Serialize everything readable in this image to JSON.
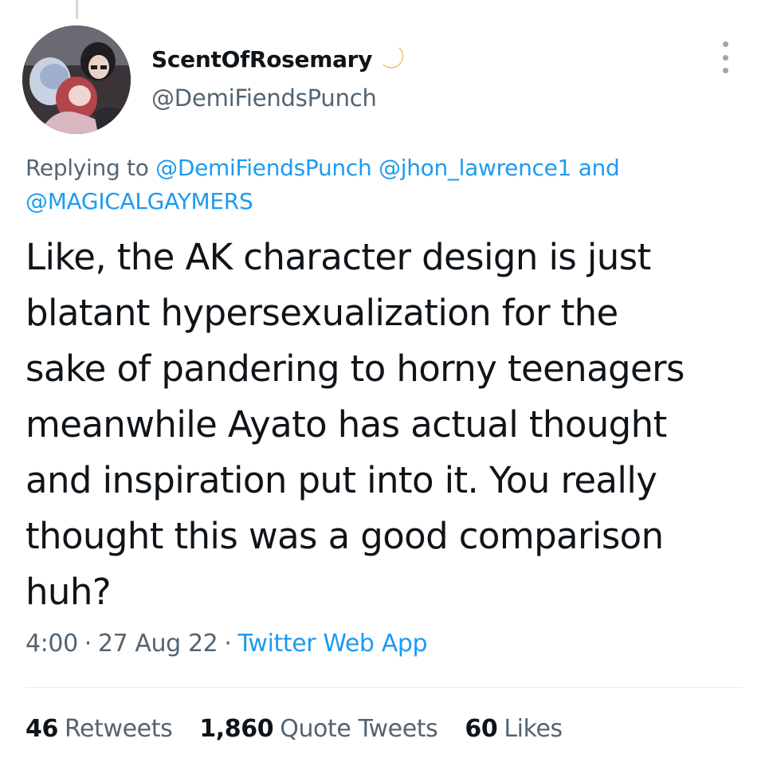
{
  "author": {
    "display_name": "ScentOfRosemary",
    "name_emoji": "crescent-moon-icon",
    "handle": "@DemiFiendsPunch"
  },
  "reply": {
    "prefix": "Replying to",
    "mentions": [
      "@DemiFiendsPunch",
      "@jhon_lawrence1"
    ],
    "conjunction": "and",
    "last_mention": "@MAGICALGAYMERS"
  },
  "tweet": {
    "text": "Like, the AK character design is just\nblatant hypersexualization for the\nsake of pandering to horny teenagers\nmeanwhile Ayato has actual thought\nand inspiration put into it. You really\nthought this was a good comparison\nhuh?"
  },
  "meta": {
    "time": "4:00",
    "date": "27 Aug 22",
    "separator": "·",
    "source": "Twitter Web App"
  },
  "stats": {
    "retweets_count": "46",
    "retweets_label": "Retweets",
    "quotes_count": "1,860",
    "quotes_label": "Quote Tweets",
    "likes_count": "60",
    "likes_label": "Likes"
  },
  "colors": {
    "link": "#1d9bf0",
    "secondary_text": "#536471",
    "primary_text": "#0f1419",
    "moon": "#f5c542"
  }
}
